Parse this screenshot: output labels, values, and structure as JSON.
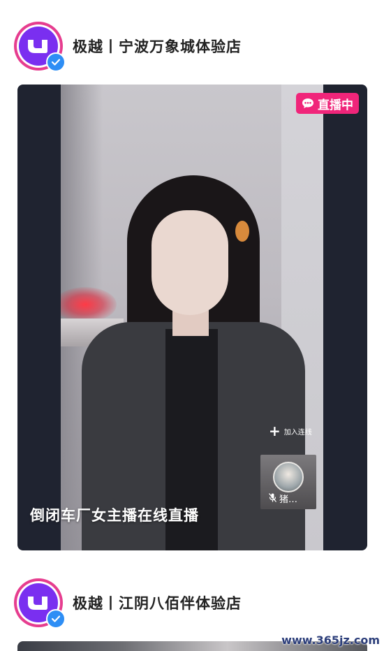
{
  "posts": [
    {
      "account_name": "极越丨宁波万象城体验店",
      "live_badge": "直播中",
      "join_link_label": "加入连线",
      "guest_name": "猪…",
      "stream_title": "倒闭车厂女主播在线直播"
    },
    {
      "account_name": "极越丨江阴八佰伴体验店"
    }
  ],
  "watermark": "www.365jz.com",
  "colors": {
    "brand_purple": "#7a2ff0",
    "avatar_ring": "#e63d8f",
    "verified_blue": "#2e8ef5",
    "live_badge_bg": "#f0257a"
  },
  "icons": {
    "avatar": "jiyue-logo-icon",
    "verified": "verified-check-icon",
    "live": "live-chat-icon",
    "join": "plus-icon",
    "mic": "mic-off-icon"
  }
}
